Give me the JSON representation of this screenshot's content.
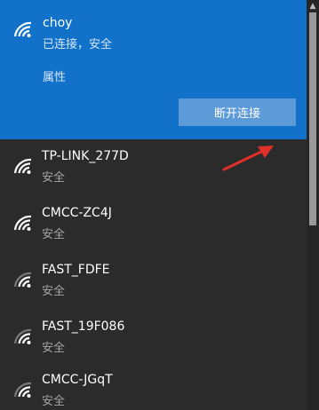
{
  "connected": {
    "name": "choy",
    "status": "已连接，安全",
    "properties_label": "属性",
    "disconnect_label": "断开连接"
  },
  "networks": [
    {
      "name": "TP-LINK_277D",
      "status": "安全"
    },
    {
      "name": "CMCC-ZC4J",
      "status": "安全"
    },
    {
      "name": "FAST_FDFE",
      "status": "安全"
    },
    {
      "name": "FAST_19F086",
      "status": "安全"
    },
    {
      "name": "CMCC-JGqT",
      "status": "安全"
    }
  ],
  "icons": {
    "wifi": "wifi-signal-icon",
    "annotation": "red-arrow-icon",
    "scroll_up": "chevron-up-icon"
  },
  "colors": {
    "connected_background": "#1271c9",
    "panel_background": "#2b2b2b",
    "disconnect_button": "#5d9ad8",
    "annotation_arrow": "#e0302b"
  }
}
